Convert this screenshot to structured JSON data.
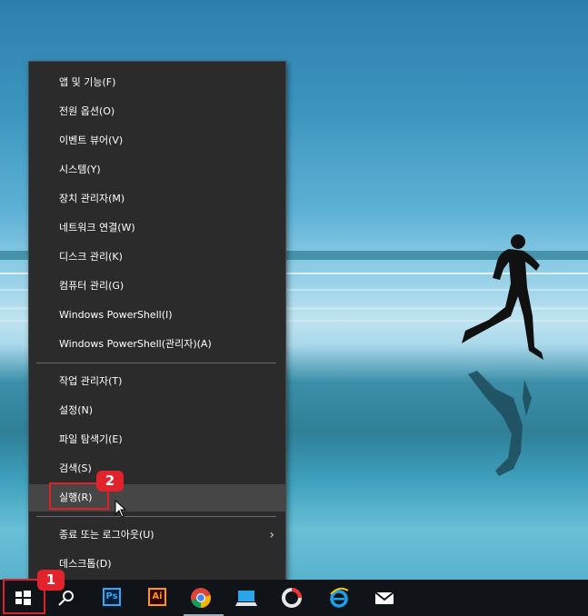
{
  "menu": {
    "items": [
      {
        "label": "앱 및 기능(F)"
      },
      {
        "label": "전원 옵션(O)"
      },
      {
        "label": "이벤트 뷰어(V)"
      },
      {
        "label": "시스템(Y)"
      },
      {
        "label": "장치 관리자(M)"
      },
      {
        "label": "네트워크 연결(W)"
      },
      {
        "label": "디스크 관리(K)"
      },
      {
        "label": "컴퓨터 관리(G)"
      },
      {
        "label": "Windows PowerShell(I)"
      },
      {
        "label": "Windows PowerShell(관리자)(A)"
      }
    ],
    "items2": [
      {
        "label": "작업 관리자(T)"
      },
      {
        "label": "설정(N)"
      },
      {
        "label": "파일 탐색기(E)"
      },
      {
        "label": "검색(S)"
      },
      {
        "label": "실행(R)"
      }
    ],
    "items3": [
      {
        "label": "종료 또는 로그아웃(U)"
      },
      {
        "label": "데스크톱(D)"
      }
    ]
  },
  "badges": {
    "one": "1",
    "two": "2"
  },
  "taskbar": {
    "icons": [
      "windows-start-icon",
      "search-icon",
      "photoshop-icon",
      "illustrator-icon",
      "chrome-icon",
      "computer-icon",
      "ring-app-icon",
      "internet-explorer-icon",
      "mail-icon"
    ],
    "photoshop_text": "Ps",
    "illustrator_text": "Ai"
  },
  "colors": {
    "menu_bg": "#2b2b2b",
    "highlight": "#464646",
    "annotation_red": "#e3232c",
    "taskbar": "#101418"
  }
}
